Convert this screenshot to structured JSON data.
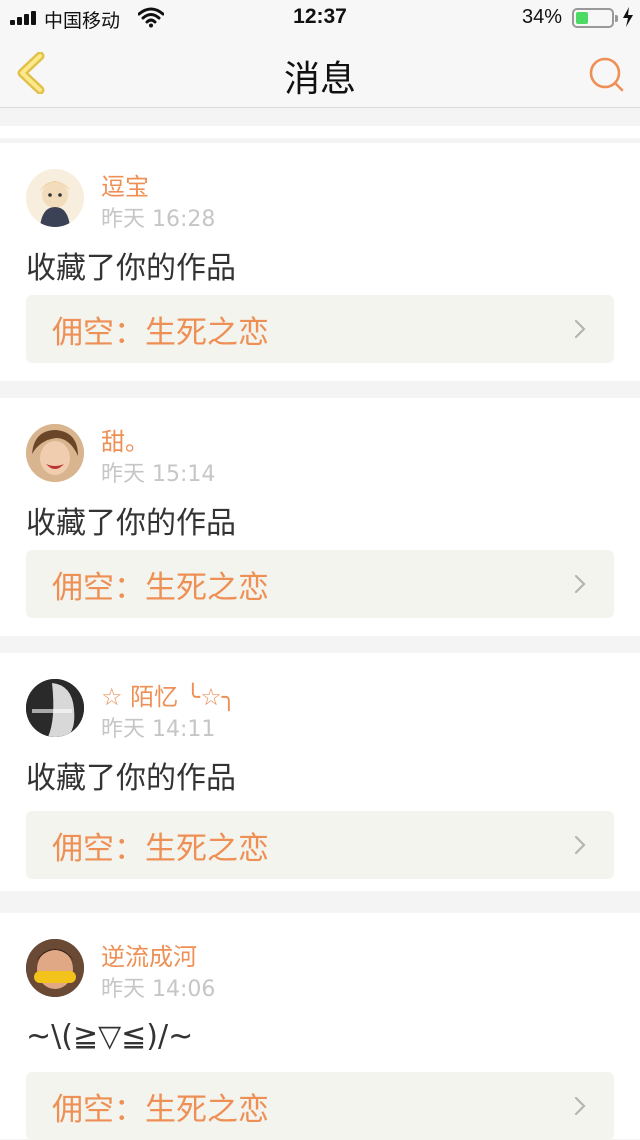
{
  "status_bar": {
    "carrier": "中国移动",
    "time": "12:37",
    "battery": "34%",
    "battery_level": 0.34
  },
  "nav": {
    "title": "消息",
    "back_icon": "chevron-left-icon",
    "search_icon": "search-icon"
  },
  "colors": {
    "accent": "#ee9055",
    "link_bg": "#f4f4ef",
    "time_gray": "#c6c6c6"
  },
  "messages": [
    {
      "user": "逗宝",
      "time": "昨天 16:28",
      "action": "收藏了你的作品",
      "work": "佣空：生死之恋"
    },
    {
      "user": "甜。",
      "time": "昨天 15:14",
      "action": "收藏了你的作品",
      "work": "佣空：生死之恋"
    },
    {
      "user": "☆ 陌忆 ╰☆╮",
      "time": "昨天 14:11",
      "action": "收藏了你的作品",
      "work": "佣空：生死之恋"
    },
    {
      "user": "逆流成河",
      "time": "昨天 14:06",
      "action": "~\\(≧▽≦)/~",
      "work": "佣空：生死之恋"
    }
  ]
}
